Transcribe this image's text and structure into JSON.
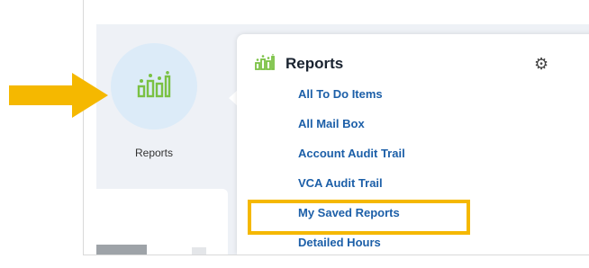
{
  "launcher": {
    "tile_label": "Reports",
    "tile_icon": "bar-chart-icon"
  },
  "panel": {
    "title": "Reports",
    "title_icon": "bar-chart-icon",
    "settings_icon": "gear-icon",
    "items": [
      {
        "label": "All To Do Items"
      },
      {
        "label": "All Mail Box"
      },
      {
        "label": "Account Audit Trail"
      },
      {
        "label": "VCA Audit Trail"
      },
      {
        "label": "My Saved Reports"
      },
      {
        "label": "Detailed Hours"
      }
    ]
  },
  "annotations": {
    "arrow_color": "#f5b800",
    "highlight_color": "#f5b800",
    "highlighted_item": "My Saved Reports"
  },
  "colors": {
    "accent_green": "#7ac143",
    "link_blue": "#1c5fa8",
    "tile_bg": "#dcebf8"
  }
}
